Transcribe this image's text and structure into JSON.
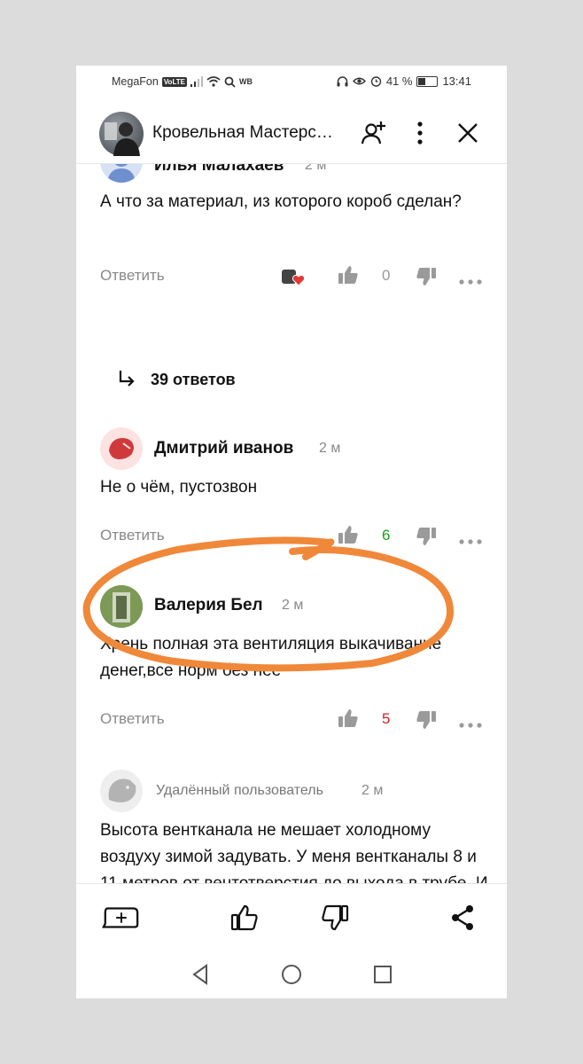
{
  "status_bar": {
    "carrier": "MegaFon",
    "volte": "VoLTE",
    "wb": "WB",
    "battery_percent": "41 %",
    "battery_level": 0.41,
    "time": "13:41"
  },
  "header": {
    "channel_title": "Кровельная Мастерс…"
  },
  "comments": [
    {
      "author": "Илья Малахаев",
      "time": "2 м",
      "text": "А что за материал, из которого короб сделан?",
      "reply_label": "Ответить",
      "likes": "0",
      "replies_label": "39 ответов"
    },
    {
      "author": "Дмитрий иванов",
      "time": "2 м",
      "text": "Не о чём, пустозвон",
      "reply_label": "Ответить",
      "likes": "6"
    },
    {
      "author": "Валерия Бел",
      "time": "2 м",
      "text": "Хрень полная эта вентиляция выкачивание денег,все норм без нее",
      "reply_label": "Ответить",
      "likes": "5"
    },
    {
      "author": "Удалённый пользователь",
      "time": "2 м",
      "text": "Высота вентканала не мешает холодному воздуху зимой задувать. У меня вентканалы 8 и 11 метров от вентотверстия до выхода в трубе. И труба утеплена как положено, и высота трубы от"
    }
  ],
  "colors": {
    "like_positive": "#1aa31a",
    "like_negative": "#d42020",
    "annotation": "#f0883a",
    "text_primary": "#111111",
    "text_secondary": "#888888"
  },
  "icons": {
    "header": [
      "subscribe-icon",
      "more-vertical-icon",
      "close-icon"
    ],
    "bottom": [
      "add-comment-icon",
      "like-icon",
      "dislike-icon",
      "share-icon"
    ],
    "nav": [
      "back-icon",
      "home-icon",
      "recents-icon"
    ]
  }
}
